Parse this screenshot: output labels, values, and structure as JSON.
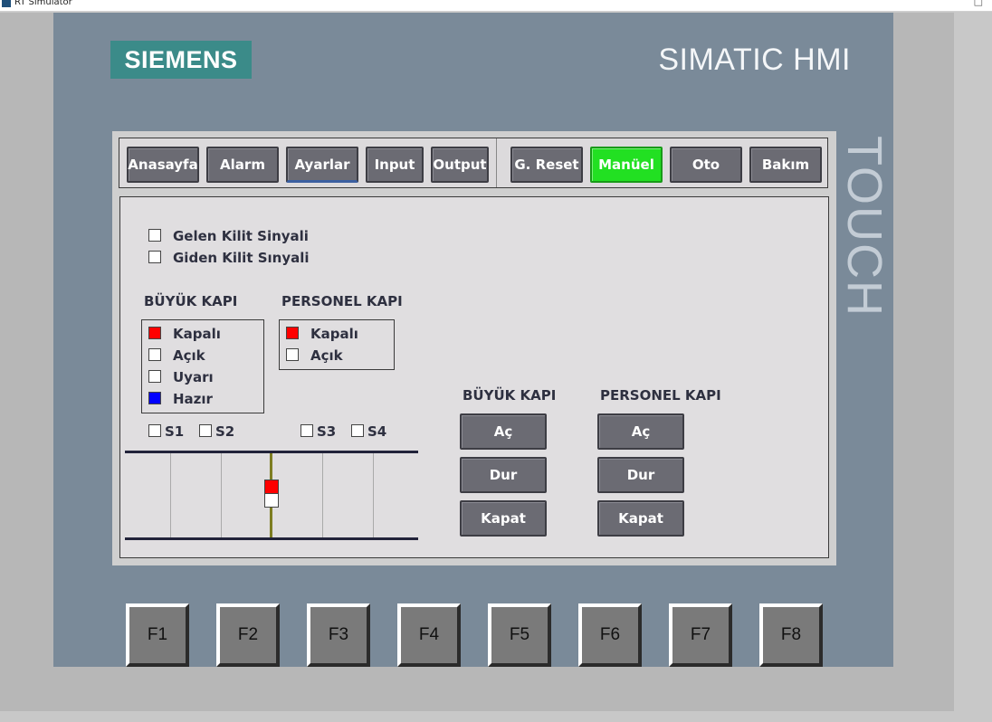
{
  "window": {
    "title": "RT Simulator"
  },
  "brand": {
    "logo": "SIEMENS",
    "product": "SIMATIC HMI",
    "touch": "TOUCH"
  },
  "nav": {
    "anasayfa": "Anasayfa",
    "alarm": "Alarm",
    "ayarlar": "Ayarlar",
    "input": "Input",
    "output": "Output",
    "g_reset": "G. Reset",
    "manuel": "Manüel",
    "oto": "Oto",
    "bakim": "Bakım",
    "active_color": "#22e022"
  },
  "signals": {
    "gelen": {
      "label": "Gelen Kilit Sinyali",
      "on": false
    },
    "giden": {
      "label": "Giden Kilit Sınyali",
      "on": false
    }
  },
  "buyuk_kapi": {
    "title": "BÜYÜK KAPI",
    "kapali": {
      "label": "Kapalı",
      "on": true,
      "color": "#ff0000"
    },
    "acik": {
      "label": "Açık",
      "on": false
    },
    "uyari": {
      "label": "Uyarı",
      "on": false
    },
    "hazir": {
      "label": "Hazır",
      "on": true,
      "color": "#0000ff"
    }
  },
  "personel_kapi": {
    "title": "PERSONEL KAPI",
    "kapali": {
      "label": "Kapalı",
      "on": true,
      "color": "#ff0000"
    },
    "acik": {
      "label": "Açık",
      "on": false
    }
  },
  "sensors": {
    "s1": "S1",
    "s2": "S2",
    "s3": "S3",
    "s4": "S4"
  },
  "controls": {
    "buyuk_title": "BÜYÜK KAPI",
    "personel_title": "PERSONEL KAPI",
    "ac": "Aç",
    "dur": "Dur",
    "kapat": "Kapat"
  },
  "fkeys": [
    "F1",
    "F2",
    "F3",
    "F4",
    "F5",
    "F6",
    "F7",
    "F8"
  ]
}
